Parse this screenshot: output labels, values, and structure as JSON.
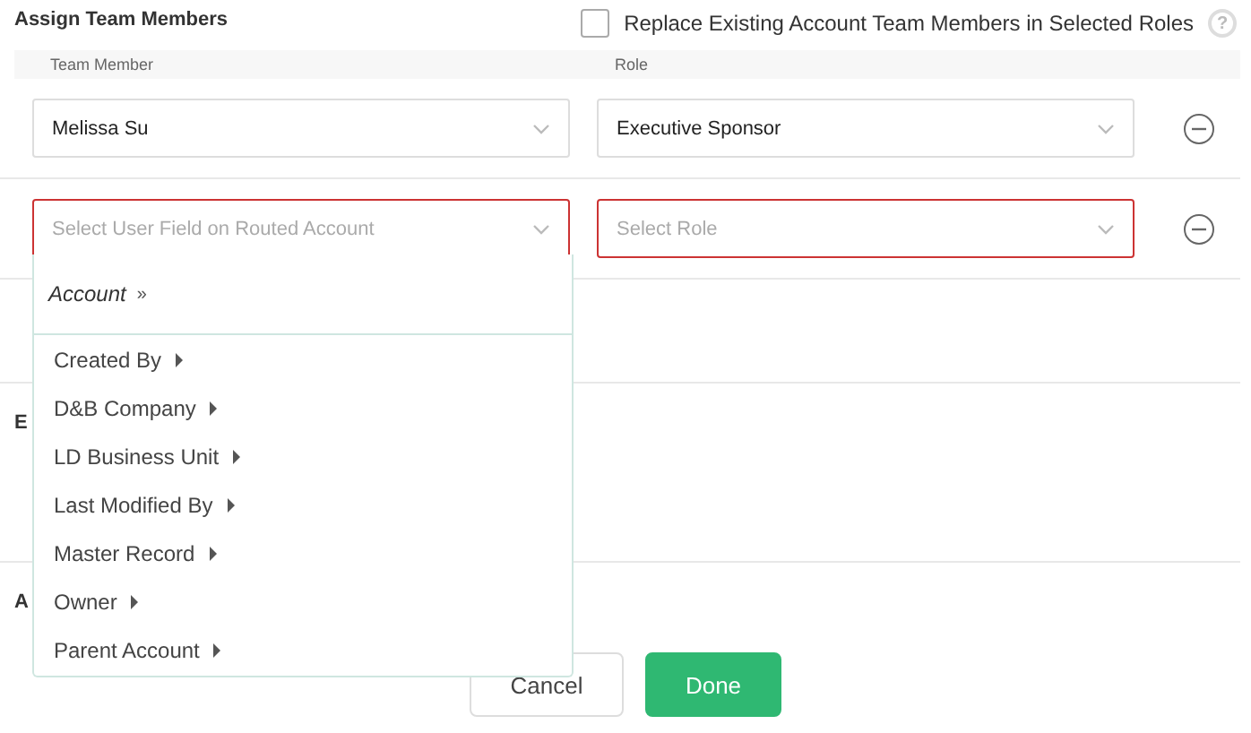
{
  "title": "Assign Team Members",
  "replace_option": {
    "label": "Replace Existing Account Team Members in Selected Roles",
    "checked": false,
    "help": "?"
  },
  "columns": [
    "Team Member",
    "Role"
  ],
  "rows": [
    {
      "member": {
        "value": "Melissa Su",
        "invalid": false
      },
      "role": {
        "value": "Executive Sponsor",
        "invalid": false
      }
    },
    {
      "member": {
        "placeholder": "Select User Field on Routed Account",
        "invalid": true
      },
      "role": {
        "placeholder": "Select Role",
        "invalid": true
      }
    }
  ],
  "sections": [
    "E",
    "A"
  ],
  "dropdown": {
    "header": "Account",
    "header_mark": "»",
    "items": [
      "Created By",
      "D&B Company",
      "LD Business Unit",
      "Last Modified By",
      "Master Record",
      "Owner",
      "Parent Account"
    ]
  },
  "buttons": [
    {
      "label": "Cancel",
      "kind": "secondary"
    },
    {
      "label": "Done",
      "kind": "primary"
    }
  ]
}
